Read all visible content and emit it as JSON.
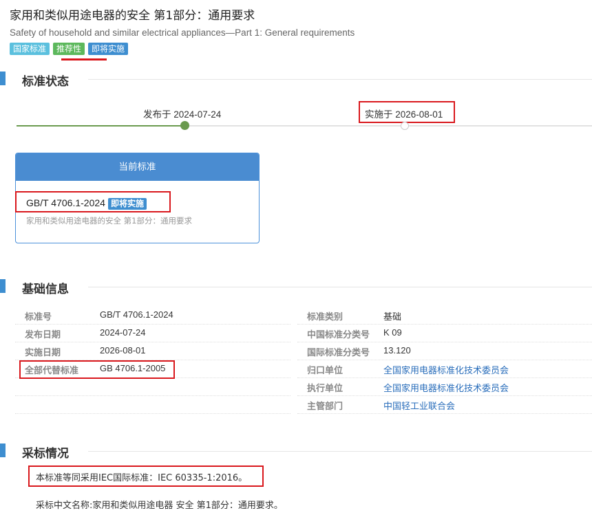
{
  "header": {
    "title_cn": "家用和类似用途电器的安全 第1部分：通用要求",
    "title_en": "Safety of household and similar electrical appliances—Part 1: General requirements",
    "tags": [
      "国家标准",
      "推荐性",
      "即将实施"
    ]
  },
  "status_section": {
    "title": "标准状态",
    "published": "发布于 2024-07-24",
    "effective": "实施于 2026-08-01"
  },
  "current_card": {
    "header": "当前标准",
    "code": "GB/T 4706.1-2024",
    "badge": "即将实施",
    "desc": "家用和类似用途电器的安全 第1部分：通用要求"
  },
  "basic_section": {
    "title": "基础信息",
    "left": [
      {
        "label": "标准号",
        "value": "GB/T 4706.1-2024"
      },
      {
        "label": "发布日期",
        "value": "2024-07-24"
      },
      {
        "label": "实施日期",
        "value": "2026-08-01"
      },
      {
        "label": "全部代替标准",
        "value": "GB 4706.1-2005"
      }
    ],
    "right": [
      {
        "label": "标准类别",
        "value": "基础"
      },
      {
        "label": "中国标准分类号",
        "value": "K 09"
      },
      {
        "label": "国际标准分类号",
        "value": "13.120"
      },
      {
        "label": "归口单位",
        "value": "全国家用电器标准化技术委员会"
      },
      {
        "label": "执行单位",
        "value": "全国家用电器标准化技术委员会"
      },
      {
        "label": "主管部门",
        "value": "中国轻工业联合会"
      }
    ]
  },
  "adopt_section": {
    "title": "采标情况",
    "line1": "本标准等同采用IEC国际标准：IEC 60335-1:2016。",
    "line2": "采标中文名称:家用和类似用途电器 安全 第1部分：通用要求。"
  },
  "colors": {
    "accent": "#3e8ed0",
    "highlight": "#d9171c",
    "timeline_done": "#6a9a4e"
  }
}
